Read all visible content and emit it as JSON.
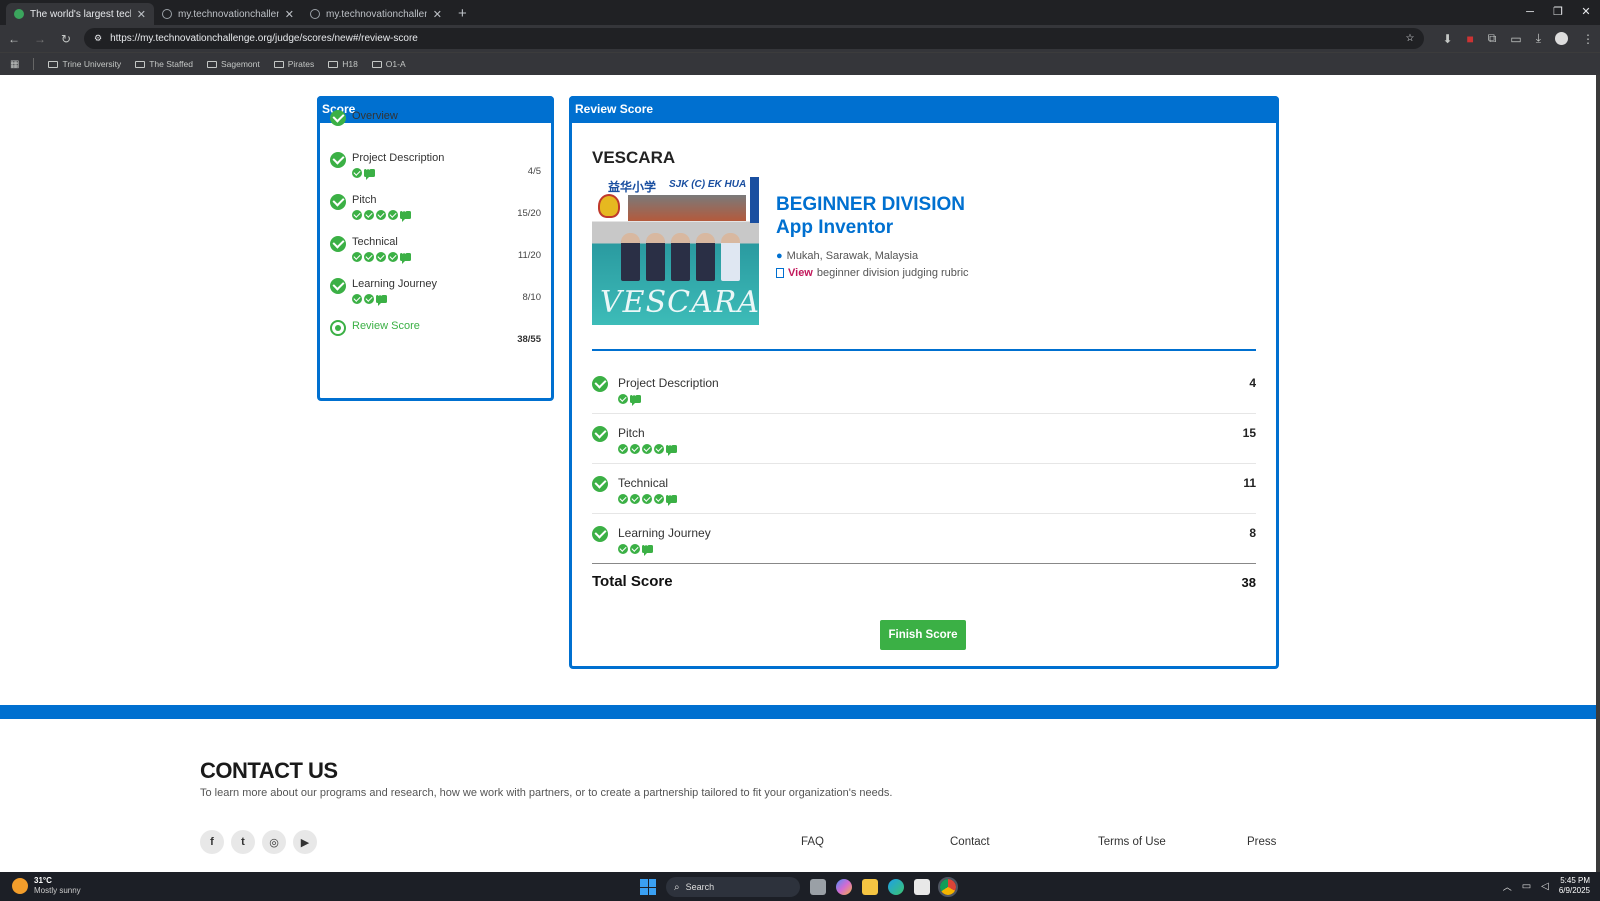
{
  "browser": {
    "tabs": [
      {
        "title": "The world's largest tech entrep",
        "active": true
      },
      {
        "title": "my.technovationchallenge.org/",
        "active": false
      },
      {
        "title": "my.technovationchallenge.org/",
        "active": false
      }
    ],
    "url": "https://my.technovationchallenge.org/judge/scores/new#/review-score",
    "bookmarks": [
      "Trine University",
      "The Staffed",
      "Sagemont",
      "Pirates",
      "H18",
      "O1-A"
    ]
  },
  "sidebar": {
    "title": "Score",
    "items": [
      {
        "label": "Overview",
        "score": "",
        "checks": 0,
        "comment": false
      },
      {
        "label": "Project Description",
        "score": "4/5",
        "checks": 1,
        "comment": true
      },
      {
        "label": "Pitch",
        "score": "15/20",
        "checks": 4,
        "comment": true
      },
      {
        "label": "Technical",
        "score": "11/20",
        "checks": 4,
        "comment": true
      },
      {
        "label": "Learning Journey",
        "score": "8/10",
        "checks": 2,
        "comment": true
      }
    ],
    "current": {
      "label": "Review Score"
    },
    "total": "38/55"
  },
  "review": {
    "title": "Review Score",
    "team": "VESCARA",
    "image_school_text": "SJK (C) EK HUA",
    "image_chinese_text": "益华小学",
    "image_caption": "VESCARA",
    "division": "BEGINNER DIVISION",
    "category": "App Inventor",
    "location": "Mukah, Sarawak, Malaysia",
    "rubric_link": "View",
    "rubric_text": "beginner division judging rubric",
    "rows": [
      {
        "label": "Project Description",
        "value": "4",
        "checks": 1,
        "comment": true
      },
      {
        "label": "Pitch",
        "value": "15",
        "checks": 4,
        "comment": true
      },
      {
        "label": "Technical",
        "value": "11",
        "checks": 4,
        "comment": true
      },
      {
        "label": "Learning Journey",
        "value": "8",
        "checks": 2,
        "comment": true
      }
    ],
    "total_label": "Total Score",
    "total_value": "38",
    "finish_button": "Finish Score"
  },
  "footer": {
    "heading": "CONTACT US",
    "text": "To learn more about our programs and research, how we work with partners, or to create a partnership tailored to fit your organization's needs.",
    "links": [
      "FAQ",
      "Contact",
      "Terms of Use",
      "Press"
    ]
  },
  "taskbar": {
    "weather_temp": "31°C",
    "weather_text": "Mostly sunny",
    "search_placeholder": "Search",
    "time": "5:45 PM",
    "date": "6/9/2025"
  },
  "colors": {
    "brand_blue": "#0070d0",
    "check_green": "#3bb045",
    "link_pink": "#c2185b"
  }
}
